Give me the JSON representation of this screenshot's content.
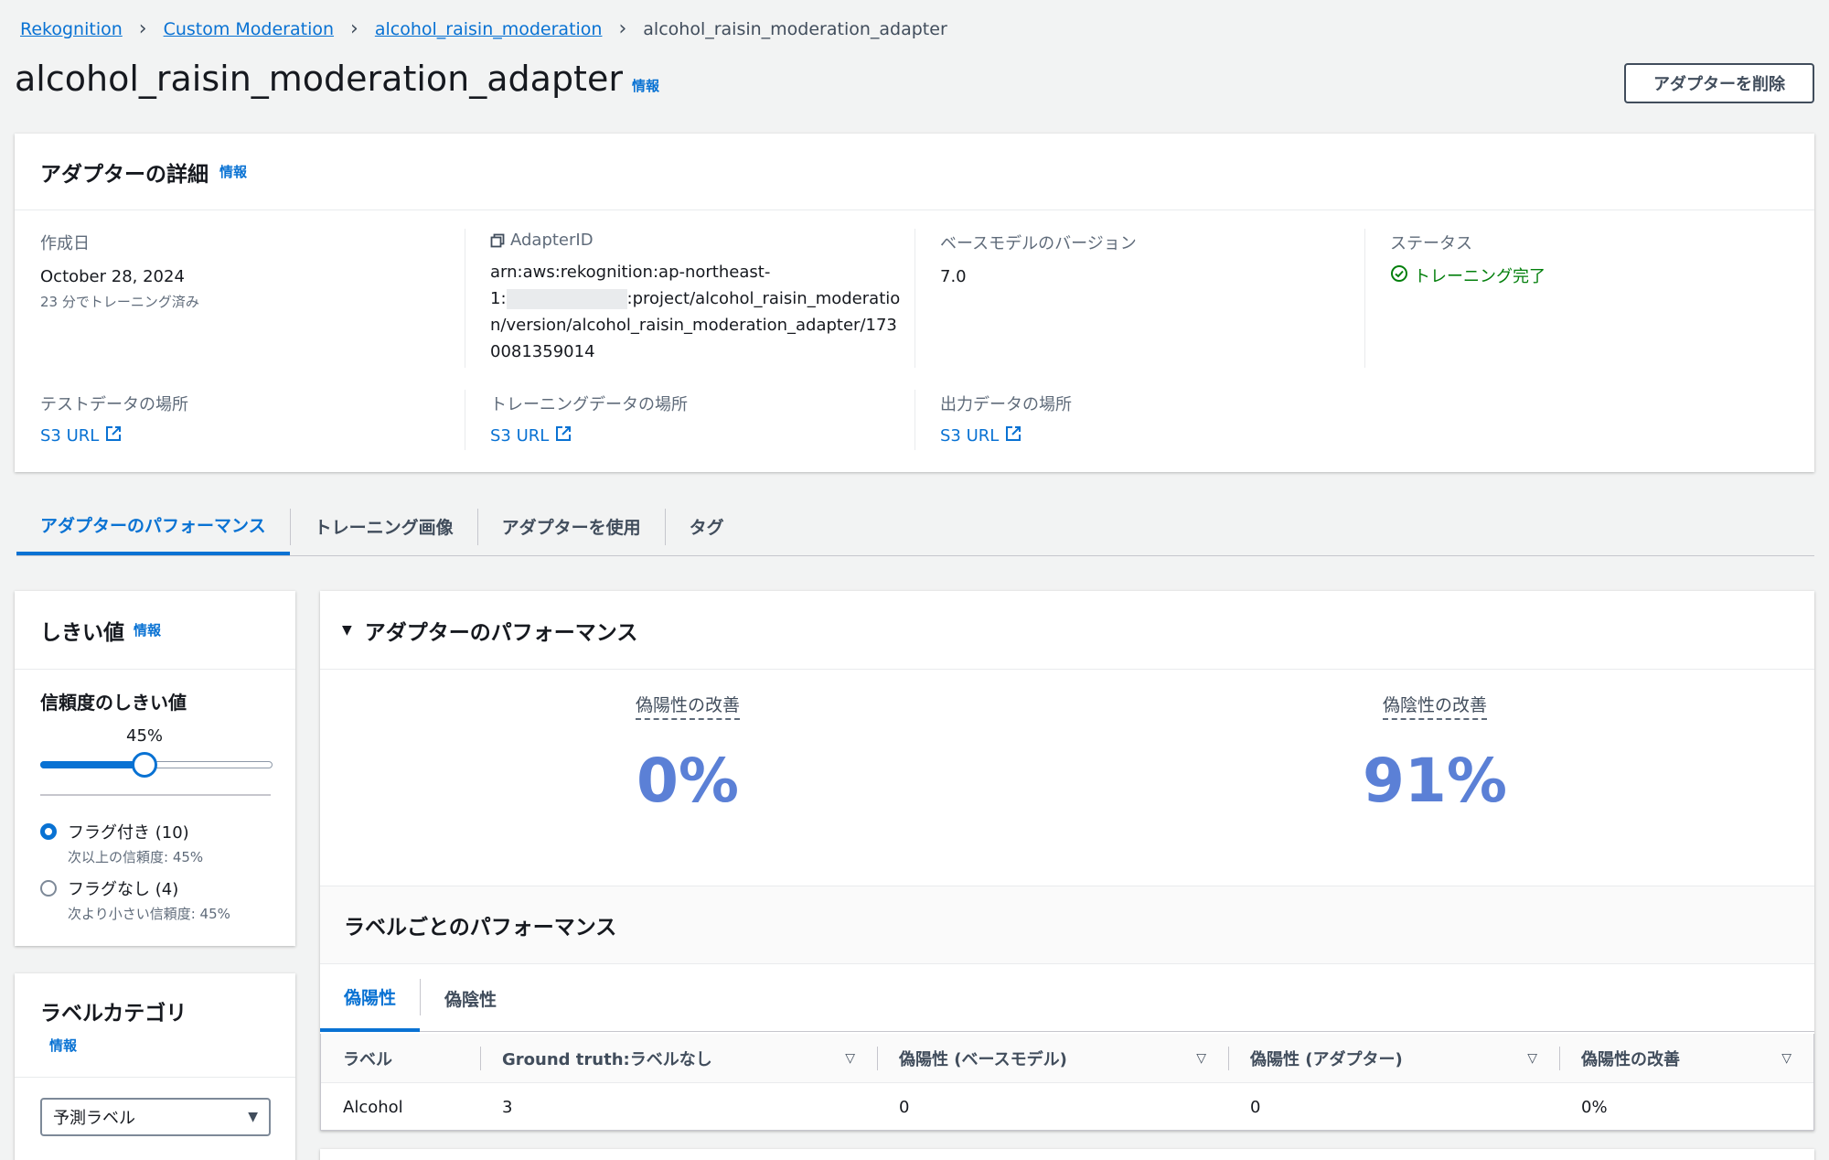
{
  "breadcrumb": {
    "items": [
      "Rekognition",
      "Custom Moderation",
      "alcohol_raisin_moderation"
    ],
    "current": "alcohol_raisin_moderation_adapter"
  },
  "header": {
    "title": "alcohol_raisin_moderation_adapter",
    "info": "情報",
    "delete_button": "アダプターを削除"
  },
  "details": {
    "title": "アダプターの詳細",
    "info": "情報",
    "created_label": "作成日",
    "created_value": "October 28, 2024",
    "created_sub": "23 分でトレーニング済み",
    "adapter_id_label": "AdapterID",
    "adapter_id_line1": "arn:aws:rekognition:ap-northeast-",
    "adapter_id_line2_prefix": "1:",
    "adapter_id_line2_suffix": ":project/alcohol_raisin_moderatio",
    "adapter_id_line3": "n/version/alcohol_raisin_moderation_adapter/173",
    "adapter_id_line4": "0081359014",
    "base_model_label": "ベースモデルのバージョン",
    "base_model_value": "7.0",
    "status_label": "ステータス",
    "status_value": "トレーニング完了",
    "test_data_label": "テストデータの場所",
    "training_data_label": "トレーニングデータの場所",
    "output_data_label": "出力データの場所",
    "s3_link": "S3 URL"
  },
  "tabs": [
    "アダプターのパフォーマンス",
    "トレーニング画像",
    "アダプターを使用",
    "タグ"
  ],
  "threshold": {
    "title": "しきい値",
    "info": "情報",
    "confidence_title": "信頼度のしきい値",
    "value_label": "45%",
    "value": 0.45,
    "flagged_label": "フラグ付き (10)",
    "flagged_sub": "次以上の信頼度: 45%",
    "unflagged_label": "フラグなし (4)",
    "unflagged_sub": "次より小さい信頼度: 45%"
  },
  "label_category": {
    "title": "ラベルカテゴリ",
    "info": "情報",
    "select_value": "予測ラベル"
  },
  "performance": {
    "title": "アダプターのパフォーマンス",
    "fp_label": "偽陽性の改善",
    "fp_value": "0%",
    "fn_label": "偽陰性の改善",
    "fn_value": "91%",
    "per_label_title": "ラベルごとのパフォーマンス",
    "subtabs": [
      "偽陽性",
      "偽陰性"
    ],
    "columns": [
      "ラベル",
      "Ground truth:ラベルなし",
      "偽陽性 (ベースモデル)",
      "偽陽性 (アダプター)",
      "偽陽性の改善"
    ],
    "rows": [
      [
        "Alcohol",
        "3",
        "0",
        "0",
        "0%"
      ]
    ]
  },
  "colors": {
    "accent": "#0972d3",
    "success": "#037f0c",
    "metric": "#5b80d6"
  }
}
